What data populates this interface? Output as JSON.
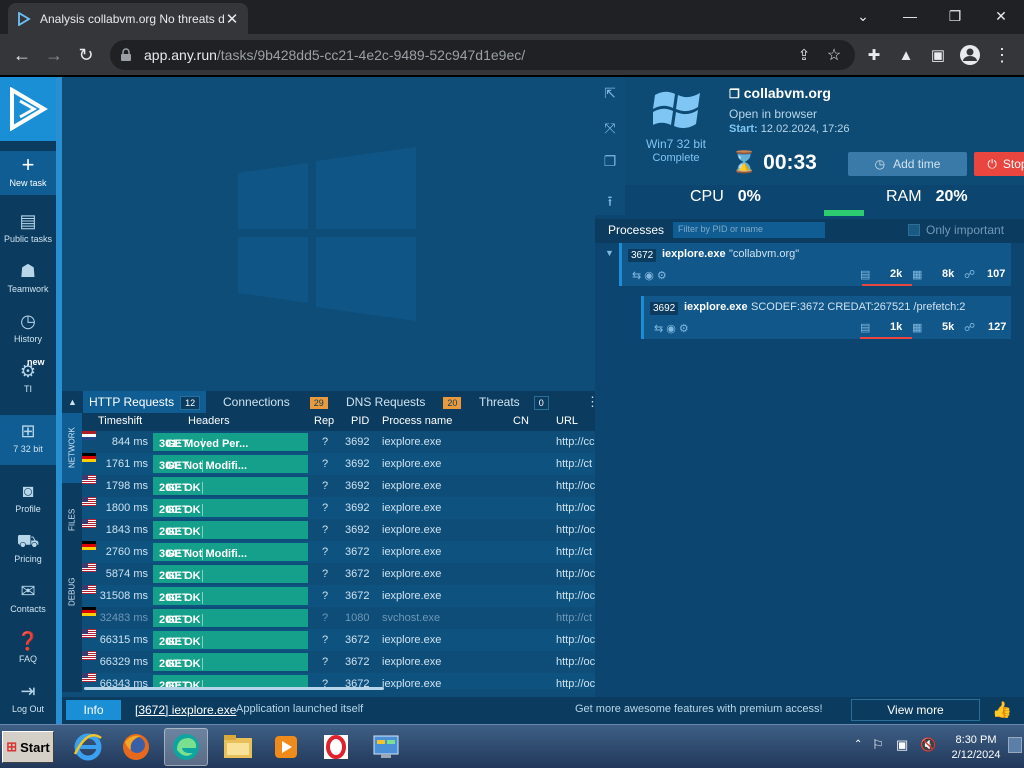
{
  "browser": {
    "tab_title": "Analysis collabvm.org No threats de",
    "url_host": "app.any.run",
    "url_path": "/tasks/9b428dd5-cc21-4e2c-9489-52c947d1e9ec/"
  },
  "nav": {
    "new_task": "New task",
    "public_tasks": "Public tasks",
    "teamwork": "Teamwork",
    "history": "History",
    "ti": "TI",
    "ti_badge": "new",
    "os": "7 32 bit",
    "profile": "Profile",
    "pricing": "Pricing",
    "contacts": "Contacts",
    "faq": "FAQ",
    "logout": "Log Out"
  },
  "task": {
    "name": "collabvm.org",
    "open_in_browser": "Open in browser",
    "start_label": "Start:",
    "start_value": "12.02.2024, 17:26",
    "os": "Win7 32 bit",
    "status": "Complete",
    "timer": "00:33",
    "add_time": "Add time",
    "stop": "Stop",
    "cpu_label": "CPU",
    "cpu_value": "0%",
    "ram_label": "RAM",
    "ram_value": "20%"
  },
  "processes": {
    "title": "Processes",
    "filter_placeholder": "Filter by PID or name",
    "only_important": "Only important",
    "items": [
      {
        "pid": "3672",
        "name": "iexplore.exe",
        "args": "\"collabvm.org\"",
        "files": "2k",
        "reg": "8k",
        "net": "107"
      },
      {
        "pid": "3692",
        "name": "iexplore.exe",
        "args": "SCODEF:3672 CREDAT:267521 /prefetch:2",
        "files": "1k",
        "reg": "5k",
        "net": "127"
      }
    ]
  },
  "bottom_tabs": [
    {
      "label": "HTTP Requests",
      "count": "12"
    },
    {
      "label": "Connections",
      "count": "29"
    },
    {
      "label": "DNS Requests",
      "count": "20"
    },
    {
      "label": "Threats",
      "count": "0"
    }
  ],
  "side_tabs": [
    "NETWORK",
    "FILES",
    "DEBUG"
  ],
  "http_table": {
    "columns": [
      "Timeshift",
      "Headers",
      "Rep",
      "PID",
      "Process name",
      "CN",
      "URL"
    ],
    "rows": [
      {
        "time": "844 ms",
        "method": "GET",
        "status": "301: Moved Per...",
        "rep": "?",
        "pid": "3692",
        "proc": "iexplore.exe",
        "cn": "nl",
        "url": "http://cc"
      },
      {
        "time": "1761 ms",
        "method": "GET",
        "status": "304: Not Modifi...",
        "rep": "?",
        "pid": "3692",
        "proc": "iexplore.exe",
        "cn": "de",
        "url": "http://ct"
      },
      {
        "time": "1798 ms",
        "method": "GET",
        "status": "200: OK",
        "rep": "?",
        "pid": "3692",
        "proc": "iexplore.exe",
        "cn": "us",
        "url": "http://oc"
      },
      {
        "time": "1800 ms",
        "method": "GET",
        "status": "200: OK",
        "rep": "?",
        "pid": "3692",
        "proc": "iexplore.exe",
        "cn": "us",
        "url": "http://oc"
      },
      {
        "time": "1843 ms",
        "method": "GET",
        "status": "200: OK",
        "rep": "?",
        "pid": "3692",
        "proc": "iexplore.exe",
        "cn": "us",
        "url": "http://oc"
      },
      {
        "time": "2760 ms",
        "method": "GET",
        "status": "304: Not Modifi...",
        "rep": "?",
        "pid": "3672",
        "proc": "iexplore.exe",
        "cn": "de",
        "url": "http://ct"
      },
      {
        "time": "5874 ms",
        "method": "GET",
        "status": "200: OK",
        "rep": "?",
        "pid": "3672",
        "proc": "iexplore.exe",
        "cn": "us",
        "url": "http://oc"
      },
      {
        "time": "31508 ms",
        "method": "GET",
        "status": "200: OK",
        "rep": "?",
        "pid": "3672",
        "proc": "iexplore.exe",
        "cn": "us",
        "url": "http://oc"
      },
      {
        "time": "32483 ms",
        "method": "GET",
        "status": "200: OK",
        "rep": "?",
        "pid": "1080",
        "proc": "svchost.exe",
        "cn": "de",
        "url": "http://ct"
      },
      {
        "time": "66315 ms",
        "method": "GET",
        "status": "200: OK",
        "rep": "?",
        "pid": "3672",
        "proc": "iexplore.exe",
        "cn": "us",
        "url": "http://oc"
      },
      {
        "time": "66329 ms",
        "method": "GET",
        "status": "200: OK",
        "rep": "?",
        "pid": "3672",
        "proc": "iexplore.exe",
        "cn": "us",
        "url": "http://oc"
      },
      {
        "time": "66343 ms",
        "method": "GET",
        "status": "200: OK",
        "rep": "?",
        "pid": "3672",
        "proc": "iexplore.exe",
        "cn": "us",
        "url": "http://oc"
      }
    ]
  },
  "infobar": {
    "info": "Info",
    "process": "[3672] iexplore.exe",
    "message": "Application launched itself",
    "premium": "Get more awesome features with premium access!",
    "view_more": "View more"
  },
  "taskbar": {
    "start": "Start",
    "time": "8:30 PM",
    "date": "2/12/2024"
  }
}
